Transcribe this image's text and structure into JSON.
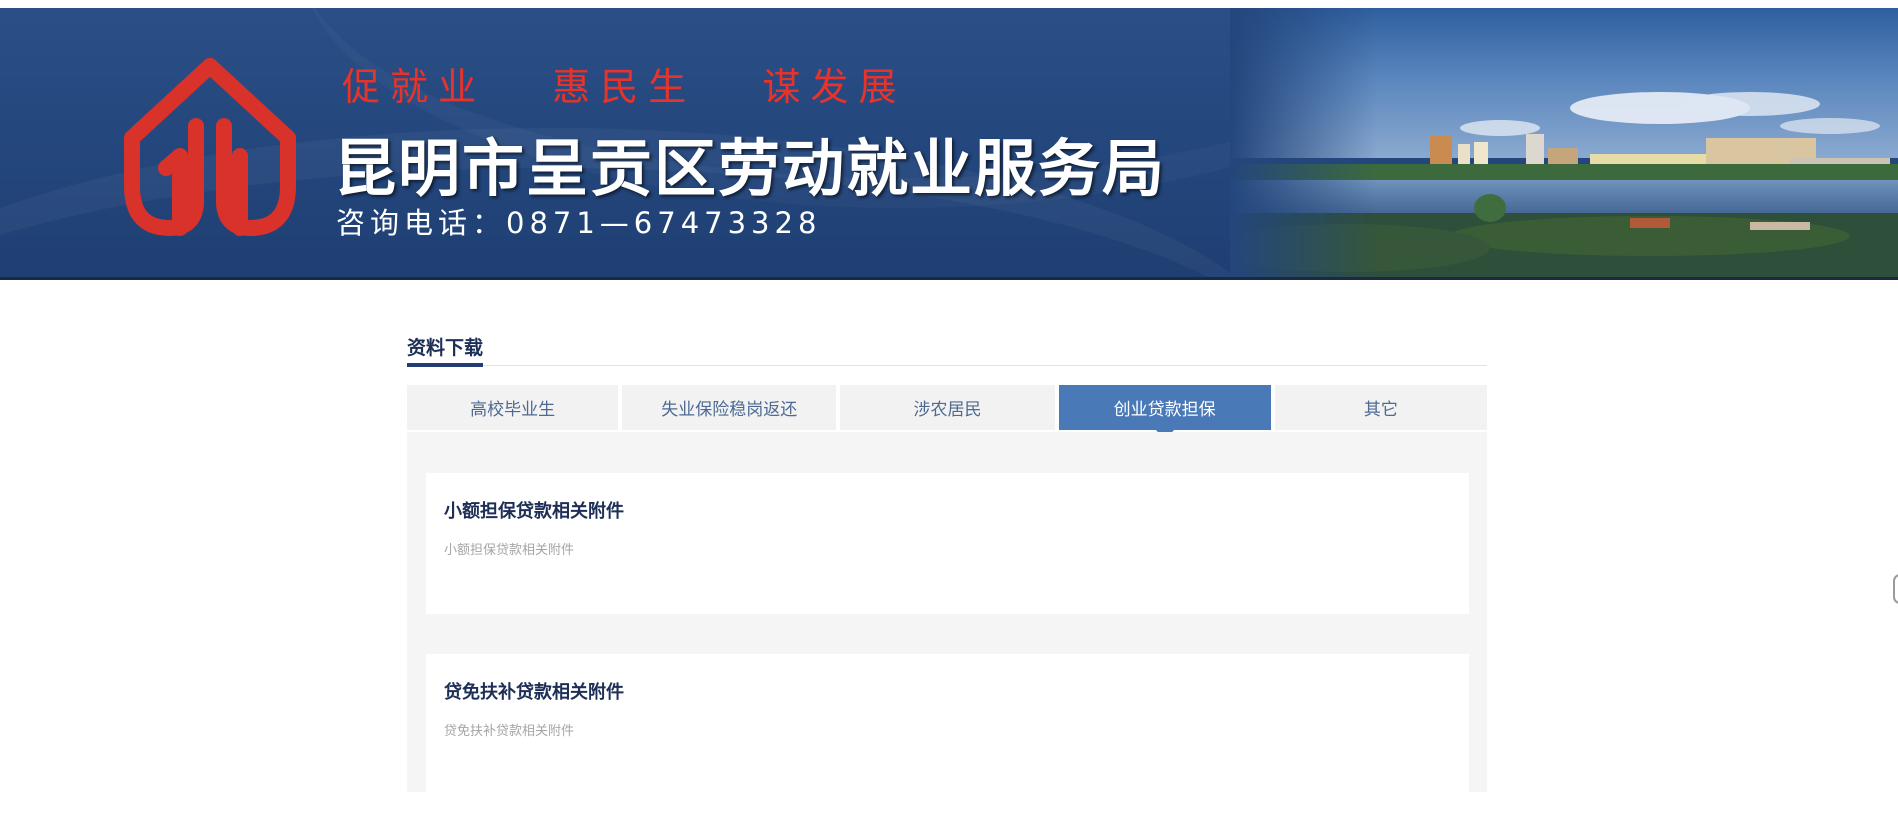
{
  "header": {
    "slogan": "促就业   惠民生   谋发展",
    "org_name": "昆明市呈贡区劳动就业服务局",
    "hotline": "咨询电话：0871—67473328",
    "logo_icon": "arrow-house-logo-icon",
    "colors": {
      "banner": "#23467c",
      "slogan": "#e8332a",
      "accent": "#4a79b8"
    }
  },
  "section": {
    "title": "资料下载"
  },
  "tabs": [
    {
      "label": "高校毕业生",
      "active": false
    },
    {
      "label": "失业保险稳岗返还",
      "active": false
    },
    {
      "label": "涉农居民",
      "active": false
    },
    {
      "label": "创业贷款担保",
      "active": true
    },
    {
      "label": "其它",
      "active": false
    }
  ],
  "cards": [
    {
      "title": "小额担保贷款相关附件",
      "desc": "小额担保贷款相关附件"
    },
    {
      "title": "贷免扶补贷款相关附件",
      "desc": "贷免扶补贷款相关附件"
    }
  ]
}
